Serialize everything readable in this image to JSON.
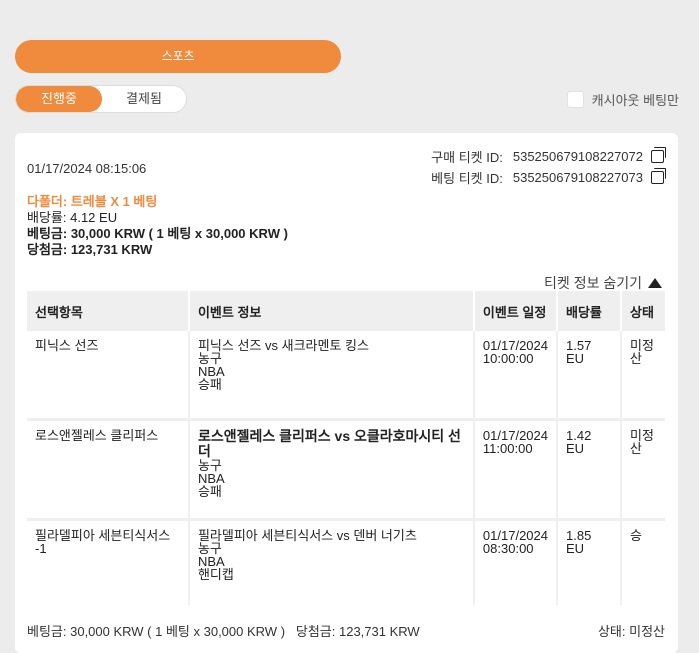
{
  "header": {
    "sports_label": "스포츠"
  },
  "tabs": [
    {
      "label": "진행중"
    },
    {
      "label": "결제됨"
    }
  ],
  "cashout": {
    "label": "캐시아웃 베팅만"
  },
  "ticket": {
    "date": "01/17/2024 08:15:06",
    "purchase_id_label": "구매 티켓 ID:",
    "purchase_id": "535250679108227072",
    "bet_id_label": "베팅 티켓 ID:",
    "bet_id": "535250679108227073",
    "bet_type": "다폴더: 트레블 X 1 베팅",
    "odds": "배당률: 4.12 EU",
    "stake": "베팅금: 30,000 KRW ( 1 베팅 x 30,000 KRW )",
    "payout": "당첨금: 123,731 KRW",
    "toggle_label": "티켓 정보 숨기기"
  },
  "table": {
    "headers": [
      "선택항목",
      "이벤트 정보",
      "이벤트 일정",
      "배당률",
      "상태"
    ],
    "rows": [
      {
        "selection": "피닉스 선즈",
        "event": "피닉스 선즈 vs 새크라멘토 킹스",
        "sport": "농구",
        "league": "NBA",
        "market": "승패",
        "date": "01/17/2024",
        "time": "10:00:00",
        "odds": "1.57 EU",
        "status": "미정산"
      },
      {
        "selection": "로스앤젤레스 클리퍼스",
        "event": "로스앤젤레스 클리퍼스 vs 오클라호마시티 선더",
        "sport": "농구",
        "league": "NBA",
        "market": "승패",
        "date": "01/17/2024",
        "time": "11:00:00",
        "odds": "1.42 EU",
        "status": "미정산"
      },
      {
        "selection": "필라델피아 세븐티식서스 -1",
        "event": "필라델피아 세븐티식서스 vs 덴버 너기츠",
        "sport": "농구",
        "league": "NBA",
        "market": "핸디캡",
        "date": "01/17/2024",
        "time": "08:30:00",
        "odds": "1.85 EU",
        "status": "승"
      }
    ]
  },
  "footer": {
    "stake": "베팅금: 30,000 KRW ( 1 베팅 x 30,000 KRW )",
    "payout": "당첨금: 123,731 KRW",
    "status": "상태: 미정산"
  },
  "colors": {
    "accent": "#f08a3c",
    "background": "#ececec"
  }
}
